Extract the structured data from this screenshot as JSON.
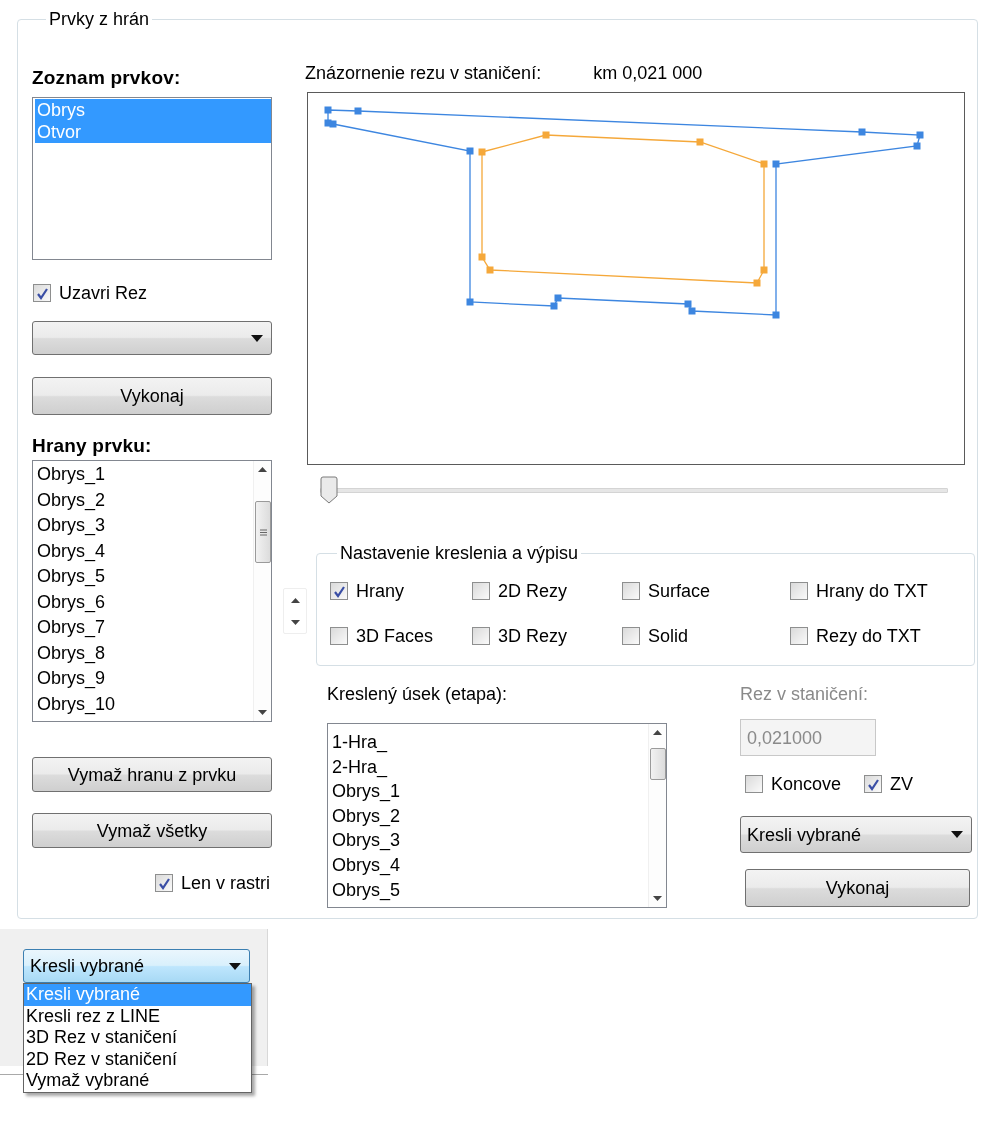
{
  "group_title": "Prvky z hrán",
  "element_list": {
    "label": "Zoznam prvkov:",
    "items": [
      {
        "label": "Obrys",
        "selected": true
      },
      {
        "label": "Otvor",
        "selected": true
      }
    ]
  },
  "close_cut": {
    "label": "Uzavri Rez",
    "checked": true
  },
  "execute_button": "Vykonaj",
  "edge_list": {
    "label": "Hrany prvku:",
    "items": [
      "Obrys_1",
      "Obrys_2",
      "Obrys_3",
      "Obrys_4",
      "Obrys_5",
      "Obrys_6",
      "Obrys_7",
      "Obrys_8",
      "Obrys_9",
      "Obrys_10"
    ]
  },
  "delete_edge_button": "Vymaž hranu z prvku",
  "delete_all_button": "Vymaž všetky",
  "grid_only": {
    "label": "Len v rastri",
    "checked": true
  },
  "preview": {
    "label": "Znázornenie rezu v staničení:",
    "station": "km 0,021 000"
  },
  "slider": {
    "level": 0
  },
  "settings": {
    "title": "Nastavenie kreslenia a výpisu",
    "options": [
      {
        "label": "Hrany",
        "checked": true
      },
      {
        "label": "2D Rezy",
        "checked": false
      },
      {
        "label": "Surface",
        "checked": false
      },
      {
        "label": "Hrany do TXT",
        "checked": false
      },
      {
        "label": "3D Faces",
        "checked": false
      },
      {
        "label": "3D Rezy",
        "checked": false
      },
      {
        "label": "Solid",
        "checked": false
      },
      {
        "label": "Rezy do TXT",
        "checked": false
      }
    ]
  },
  "segment": {
    "label": "Kreslený úsek (etapa):",
    "items": [
      "1-Hra_",
      "2-Hra_",
      "Obrys_1",
      "Obrys_2",
      "Obrys_3",
      "Obrys_4",
      "Obrys_5"
    ]
  },
  "station": {
    "label": "Rez v staničení:",
    "value": "0,021000",
    "disabled": true
  },
  "end_sections": {
    "label": "Koncove",
    "checked": false
  },
  "zv": {
    "label": "ZV",
    "checked": true
  },
  "action_combo": {
    "value": "Kresli vybrané"
  },
  "execute_button_2": "Vykonaj",
  "dropdown_popup": {
    "value": "Kresli vybrané",
    "options": [
      {
        "label": "Kresli vybrané",
        "selected": true
      },
      {
        "label": "Kresli rez z LINE",
        "selected": false
      },
      {
        "label": "3D Rez v staničení",
        "selected": false
      },
      {
        "label": "2D Rez v staničení",
        "selected": false
      },
      {
        "label": "Vymaž vybrané",
        "selected": false
      }
    ]
  }
}
